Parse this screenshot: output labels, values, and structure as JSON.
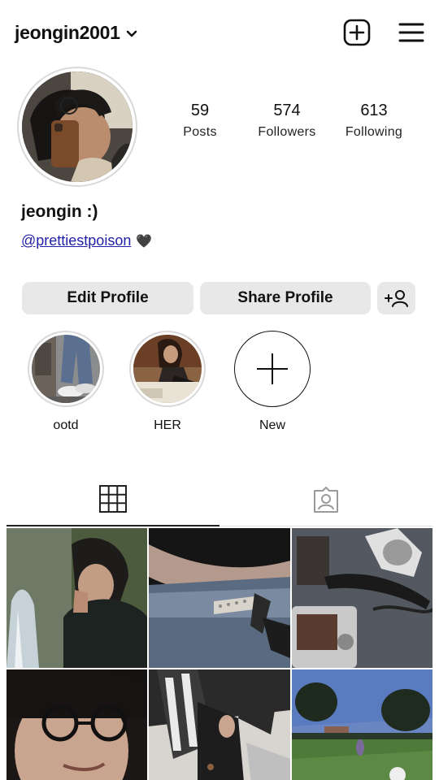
{
  "header": {
    "username": "jeongin2001",
    "icons": [
      "chevron-down-icon",
      "new-post-icon",
      "menu-icon"
    ]
  },
  "stats": [
    {
      "value": "59",
      "label": "Posts"
    },
    {
      "value": "574",
      "label": "Followers"
    },
    {
      "value": "613",
      "label": "Following"
    }
  ],
  "profile": {
    "display_name": "jeongin :)",
    "bio_link": "@prettiestpoison",
    "bio_emoji": "🖤"
  },
  "buttons": {
    "edit": "Edit Profile",
    "share": "Share Profile",
    "add_icon": "add-person-icon"
  },
  "highlights": [
    {
      "label": "ootd"
    },
    {
      "label": "HER"
    },
    {
      "label": "New"
    }
  ],
  "tabs": [
    {
      "icon": "grid-icon",
      "active": true
    },
    {
      "icon": "tagged-icon",
      "active": false
    }
  ],
  "posts_count_visible": 6
}
